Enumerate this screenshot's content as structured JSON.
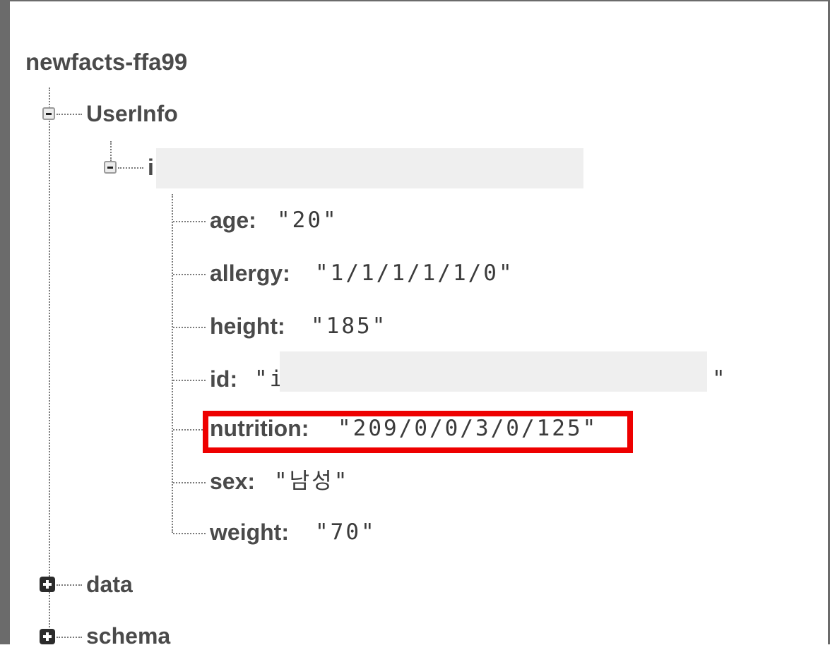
{
  "root": {
    "name": "newfacts-ffa99"
  },
  "tree": {
    "userinfo": {
      "label": "UserInfo",
      "child_key_prefix": "i",
      "fields": [
        {
          "key": "age:",
          "value": "\"20\""
        },
        {
          "key": "allergy:",
          "value": "\"1/1/1/1/1/0\""
        },
        {
          "key": "height:",
          "value": "\"185\""
        },
        {
          "key": "id:",
          "value": "\"i",
          "value_suffix": "\""
        },
        {
          "key": "nutrition:",
          "value": "\"209/0/0/3/0/125\""
        },
        {
          "key": "sex:",
          "value": "\"남성\""
        },
        {
          "key": "weight:",
          "value": "\"70\""
        }
      ]
    },
    "data": {
      "label": "data"
    },
    "schema": {
      "label": "schema"
    }
  },
  "colors": {
    "highlight": "#ee0000",
    "text": "#4a4a4a",
    "redaction": "#efefef"
  }
}
